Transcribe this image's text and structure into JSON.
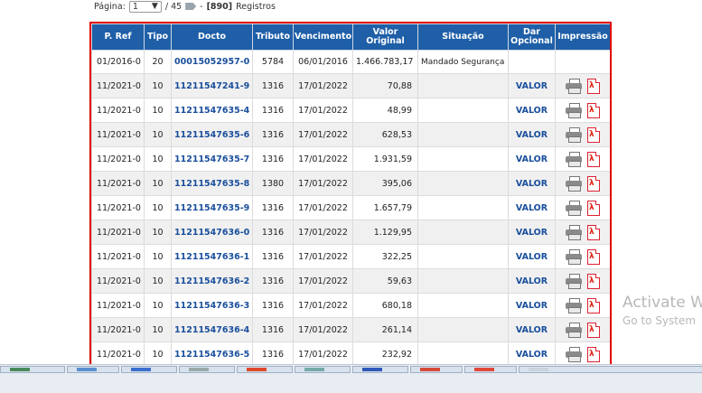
{
  "pager": {
    "label": "Página:",
    "current_page": "1",
    "separator": "/ 45",
    "dash": "-",
    "records_count": "[890]",
    "records_label": "Registros"
  },
  "table": {
    "headers": {
      "pref": "P. Ref",
      "tipo": "Tipo",
      "docto": "Docto",
      "tributo": "Tributo",
      "vencimento": "Vencimento",
      "valor": "Valor Original",
      "situacao": "Situação",
      "dar": "Dar Opcional",
      "impressao": "Impressão"
    },
    "rows": [
      {
        "pref": "01/2016-0",
        "tipo": "20",
        "docto": "00015052957-0",
        "tributo": "5784",
        "vencimento": "06/01/2016",
        "valor": "1.466.783,17",
        "situacao": "Mandado Segurança",
        "dar": "",
        "impressao": false
      },
      {
        "pref": "11/2021-0",
        "tipo": "10",
        "docto": "11211547241-9",
        "tributo": "1316",
        "vencimento": "17/01/2022",
        "valor": "70,88",
        "situacao": "",
        "dar": "VALOR",
        "impressao": true
      },
      {
        "pref": "11/2021-0",
        "tipo": "10",
        "docto": "11211547635-4",
        "tributo": "1316",
        "vencimento": "17/01/2022",
        "valor": "48,99",
        "situacao": "",
        "dar": "VALOR",
        "impressao": true
      },
      {
        "pref": "11/2021-0",
        "tipo": "10",
        "docto": "11211547635-6",
        "tributo": "1316",
        "vencimento": "17/01/2022",
        "valor": "628,53",
        "situacao": "",
        "dar": "VALOR",
        "impressao": true
      },
      {
        "pref": "11/2021-0",
        "tipo": "10",
        "docto": "11211547635-7",
        "tributo": "1316",
        "vencimento": "17/01/2022",
        "valor": "1.931,59",
        "situacao": "",
        "dar": "VALOR",
        "impressao": true
      },
      {
        "pref": "11/2021-0",
        "tipo": "10",
        "docto": "11211547635-8",
        "tributo": "1380",
        "vencimento": "17/01/2022",
        "valor": "395,06",
        "situacao": "",
        "dar": "VALOR",
        "impressao": true
      },
      {
        "pref": "11/2021-0",
        "tipo": "10",
        "docto": "11211547635-9",
        "tributo": "1316",
        "vencimento": "17/01/2022",
        "valor": "1.657,79",
        "situacao": "",
        "dar": "VALOR",
        "impressao": true
      },
      {
        "pref": "11/2021-0",
        "tipo": "10",
        "docto": "11211547636-0",
        "tributo": "1316",
        "vencimento": "17/01/2022",
        "valor": "1.129,95",
        "situacao": "",
        "dar": "VALOR",
        "impressao": true
      },
      {
        "pref": "11/2021-0",
        "tipo": "10",
        "docto": "11211547636-1",
        "tributo": "1316",
        "vencimento": "17/01/2022",
        "valor": "322,25",
        "situacao": "",
        "dar": "VALOR",
        "impressao": true
      },
      {
        "pref": "11/2021-0",
        "tipo": "10",
        "docto": "11211547636-2",
        "tributo": "1316",
        "vencimento": "17/01/2022",
        "valor": "59,63",
        "situacao": "",
        "dar": "VALOR",
        "impressao": true
      },
      {
        "pref": "11/2021-0",
        "tipo": "10",
        "docto": "11211547636-3",
        "tributo": "1316",
        "vencimento": "17/01/2022",
        "valor": "680,18",
        "situacao": "",
        "dar": "VALOR",
        "impressao": true
      },
      {
        "pref": "11/2021-0",
        "tipo": "10",
        "docto": "11211547636-4",
        "tributo": "1316",
        "vencimento": "17/01/2022",
        "valor": "261,14",
        "situacao": "",
        "dar": "VALOR",
        "impressao": true
      },
      {
        "pref": "11/2021-0",
        "tipo": "10",
        "docto": "11211547636-5",
        "tributo": "1316",
        "vencimento": "17/01/2022",
        "valor": "232,92",
        "situacao": "",
        "dar": "VALOR",
        "impressao": true
      }
    ]
  },
  "watermark": {
    "line1": "Activate W",
    "line2": "Go to System"
  },
  "icons": {
    "pager_dropdown": "chevron-down-icon",
    "pager_tag": "tag-icon",
    "print": "printer-icon",
    "pdf": "pdf-icon"
  },
  "colors": {
    "header_bg": "#1f5fa8",
    "link": "#1a4f9c",
    "frame_border": "#e00000",
    "alt_row": "#f0f0f0"
  }
}
